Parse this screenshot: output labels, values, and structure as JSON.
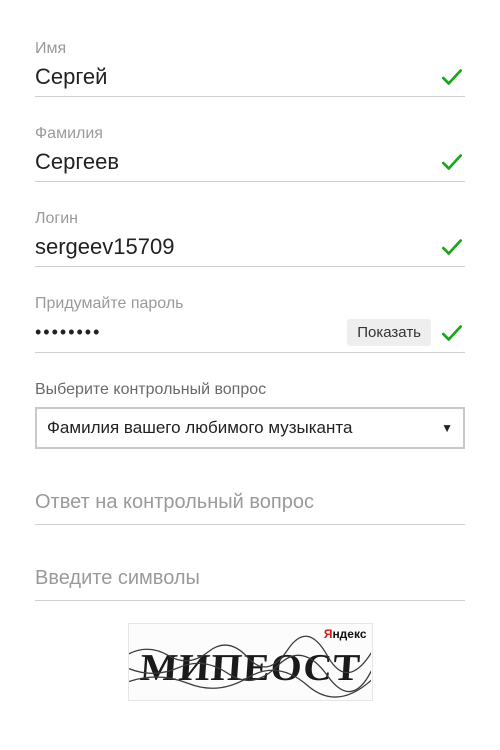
{
  "fields": {
    "first_name": {
      "label": "Имя",
      "value": "Сергей",
      "valid": true
    },
    "last_name": {
      "label": "Фамилия",
      "value": "Сергеев",
      "valid": true
    },
    "login": {
      "label": "Логин",
      "value": "sergeev15709",
      "valid": true
    },
    "password": {
      "label": "Придумайте пароль",
      "value": "••••••••",
      "show_button": "Показать",
      "valid": true
    },
    "security_question": {
      "label": "Выберите контрольный вопрос",
      "selected": "Фамилия вашего любимого музыканта"
    }
  },
  "sections": {
    "answer_header": "Ответ на контрольный вопрос",
    "captcha_header": "Введите символы"
  },
  "captcha": {
    "brand": "ндекс",
    "brand_first": "Я",
    "text": "МИПЕОСТ"
  },
  "colors": {
    "valid": "#1aa51a"
  }
}
